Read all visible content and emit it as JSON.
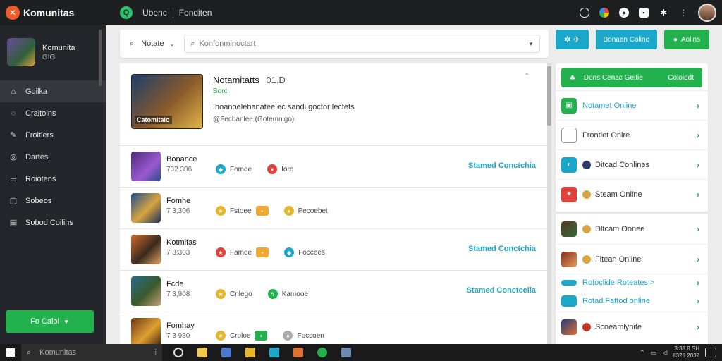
{
  "app": {
    "title": "Komunitas"
  },
  "topbar": {
    "crumb1": "Ubenc",
    "crumb2": "Fonditen",
    "badge": "Q"
  },
  "sidebar": {
    "profile": {
      "name": "Komunita",
      "sub": "GIG"
    },
    "items": [
      {
        "label": "Goilka",
        "icon": "home-icon"
      },
      {
        "label": "Craitoins",
        "icon": "chat-icon"
      },
      {
        "label": "Froitiers",
        "icon": "brush-icon"
      },
      {
        "label": "Dartes",
        "icon": "globe-icon"
      },
      {
        "label": "Roiotens",
        "icon": "list-icon"
      },
      {
        "label": "Sobeos",
        "icon": "box-icon"
      },
      {
        "label": "Sobod Coilins",
        "icon": "chart-icon"
      }
    ],
    "button": "Fo Calol"
  },
  "main": {
    "filter_label": "Notate",
    "search_placeholder": "Konfonmlnoctart",
    "hero": {
      "title": "Notamitatts",
      "version": "01.D",
      "green": "Borci",
      "image_label": "Catomitaio",
      "desc": "Ihoanoelehanatee ec sandi goctor lectets",
      "meta": "@Fecbanlee (Gotemnigo)"
    },
    "rows": [
      {
        "name": "Bonance",
        "count": "732.306",
        "tags": [
          "Fomde",
          "Ioro"
        ],
        "action": "Stamed Conctchia"
      },
      {
        "name": "Fomhe",
        "count": "7 3,306",
        "tags": [
          "Fstoee",
          "",
          "Pecoebet"
        ],
        "action": ""
      },
      {
        "name": "Kotmitas",
        "count": "7 3:303",
        "tags": [
          "Famde",
          "",
          "Foccees"
        ],
        "action": "Stamed Conctchia"
      },
      {
        "name": "Fcde",
        "count": "7 3,908",
        "tags": [
          "Cnlego",
          "Kamooe"
        ],
        "action": "Stamed Conctcella"
      },
      {
        "name": "Fomhay",
        "count": "7 3 930",
        "tags": [
          "Croloe",
          "",
          "Foccoen"
        ],
        "action": ""
      }
    ]
  },
  "right": {
    "btn_blue": "Bonaan Coline",
    "btn_green": "Aolins",
    "header": {
      "left": "Dons Cenac Geitie",
      "right": "Coloiddt"
    },
    "card1_items": [
      {
        "label": "Notamet Online",
        "style": "teal"
      },
      {
        "label": "Frontiet Onlre",
        "style": ""
      },
      {
        "label": "Ditcad Conlines",
        "style": ""
      },
      {
        "label": "Steam Online",
        "style": ""
      }
    ],
    "card2_items": [
      {
        "label": "Dltcam Oonee",
        "style": ""
      },
      {
        "label": "Fitean Online",
        "style": ""
      },
      {
        "label": "Rotoclide Roteates >",
        "style": "teal"
      },
      {
        "label": "Rotad Fattod online",
        "style": "teal"
      },
      {
        "label": "Scoeamlynite",
        "style": ""
      }
    ]
  },
  "taskbar": {
    "search": "Komunitas",
    "clock_time": "3:38 8 SH",
    "clock_date": "8328 2032"
  },
  "colors": {
    "accent_green": "#22b14c",
    "accent_teal": "#1aa7c9",
    "brand_orange": "#f15a29"
  }
}
